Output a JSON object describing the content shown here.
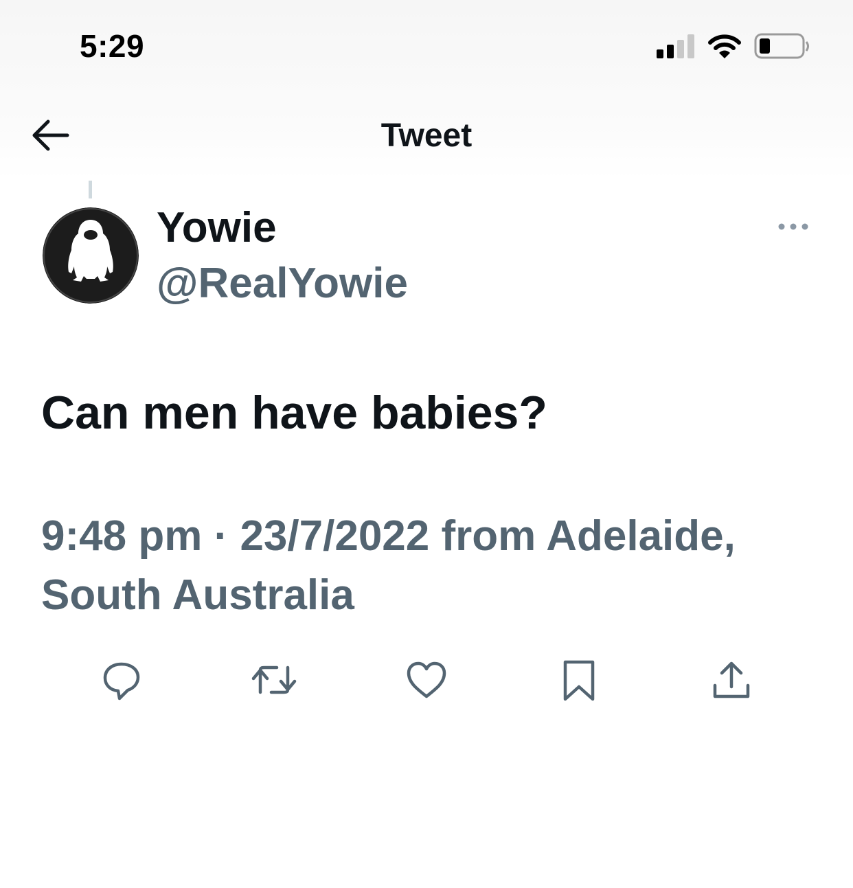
{
  "status_bar": {
    "time": "5:29",
    "signal_icon": "cellular-signal-icon",
    "wifi_icon": "wifi-icon",
    "battery_icon": "battery-low-icon"
  },
  "header": {
    "back_icon": "arrow-left-icon",
    "title": "Tweet"
  },
  "tweet": {
    "author": {
      "display_name": "Yowie",
      "handle": "@RealYowie",
      "avatar_icon": "yowie-silhouette-avatar"
    },
    "more_icon": "more-horizontal-icon",
    "text": "Can men have babies?",
    "time": "9:48 pm",
    "separator": "·",
    "date": "23/7/2022",
    "location_line1": "from Adelaide,",
    "location_line2": "South Australia",
    "actions": [
      {
        "name": "reply",
        "icon": "reply-icon"
      },
      {
        "name": "retweet",
        "icon": "retweet-icon"
      },
      {
        "name": "like",
        "icon": "heart-icon"
      },
      {
        "name": "bookmark",
        "icon": "bookmark-icon"
      },
      {
        "name": "share",
        "icon": "share-icon"
      }
    ]
  },
  "colors": {
    "primary_text": "#0f1419",
    "secondary_text": "#536471",
    "thread_line": "#cfd9de"
  }
}
